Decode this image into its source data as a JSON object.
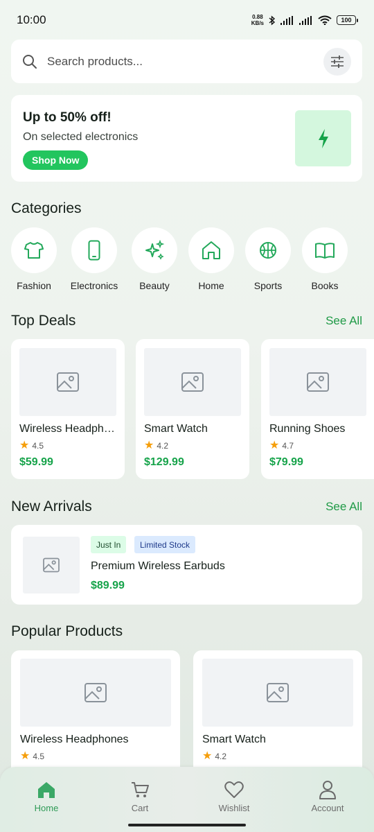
{
  "status": {
    "time": "10:00",
    "net_speed_value": "0.88",
    "net_speed_unit": "KB/s",
    "battery": "100"
  },
  "search": {
    "placeholder": "Search products..."
  },
  "promo": {
    "title": "Up to 50% off!",
    "subtitle": "On selected electronics",
    "button": "Shop Now"
  },
  "sections": {
    "categories": "Categories",
    "top_deals": "Top Deals",
    "new_arrivals": "New Arrivals",
    "popular": "Popular Products",
    "see_all": "See All"
  },
  "categories": [
    {
      "label": "Fashion",
      "icon": "tshirt-icon"
    },
    {
      "label": "Electronics",
      "icon": "smartphone-icon"
    },
    {
      "label": "Beauty",
      "icon": "sparkles-icon"
    },
    {
      "label": "Home",
      "icon": "house-icon"
    },
    {
      "label": "Sports",
      "icon": "basketball-icon"
    },
    {
      "label": "Books",
      "icon": "book-icon"
    }
  ],
  "top_deals": [
    {
      "name": "Wireless Headphones",
      "rating": "4.5",
      "price": "$59.99"
    },
    {
      "name": "Smart Watch",
      "rating": "4.2",
      "price": "$129.99"
    },
    {
      "name": "Running Shoes",
      "rating": "4.7",
      "price": "$79.99"
    }
  ],
  "new_arrival": {
    "tags": [
      "Just In",
      "Limited Stock"
    ],
    "name": "Premium Wireless Earbuds",
    "price": "$89.99"
  },
  "popular": [
    {
      "name": "Wireless Headphones",
      "rating": "4.5"
    },
    {
      "name": "Smart Watch",
      "rating": "4.2"
    }
  ],
  "nav": [
    {
      "label": "Home",
      "icon": "home-icon",
      "active": true
    },
    {
      "label": "Cart",
      "icon": "cart-icon",
      "active": false
    },
    {
      "label": "Wishlist",
      "icon": "heart-icon",
      "active": false
    },
    {
      "label": "Account",
      "icon": "person-icon",
      "active": false
    }
  ],
  "colors": {
    "accent": "#22c55e",
    "price": "#16a34a",
    "see_all": "#1f9a46",
    "star": "#f59e0b"
  }
}
